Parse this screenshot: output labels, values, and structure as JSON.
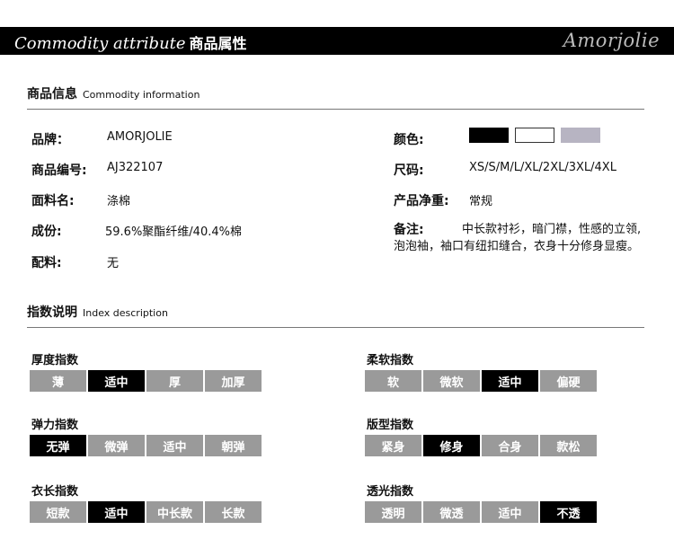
{
  "banner": {
    "title_en": "Commodity attribute",
    "title_zh": "商品属性",
    "brand_script": "Amorjolie"
  },
  "commodity": {
    "heading_zh": "商品信息",
    "heading_en": "Commodity information",
    "left": [
      {
        "label": "品牌：",
        "value": "AMORJOLIE"
      },
      {
        "label": "商品编号:",
        "value": "AJ322107"
      },
      {
        "label": "面料名:",
        "value": "涤棉"
      },
      {
        "label": "成份:",
        "value": "59.6%聚酯纤维/40.4%棉"
      },
      {
        "label": "配料:",
        "value": "无"
      }
    ],
    "color_label": "颜色:",
    "colors": [
      "#000000",
      "#ffffff",
      "#b7b4c2"
    ],
    "size_label": "尺码:",
    "size_value": "XS/S/M/L/XL/2XL/3XL/4XL",
    "weight_label": "产品净重:",
    "weight_value": "常规",
    "note_label": "备注:",
    "note_line1": "中长款衬衫，暗门襟，性感的立领,",
    "note_line2": "泡泡袖，袖口有纽扣缝合，衣身十分修身显瘦。"
  },
  "index": {
    "heading_zh": "指数说明",
    "heading_en": "Index description",
    "groups": [
      {
        "label": "厚度指数",
        "options": [
          "薄",
          "适中",
          "厚",
          "加厚"
        ],
        "selected": 1
      },
      {
        "label": "柔软指数",
        "options": [
          "软",
          "微软",
          "适中",
          "偏硬"
        ],
        "selected": 2
      },
      {
        "label": "弹力指数",
        "options": [
          "无弹",
          "微弹",
          "适中",
          "朝弹"
        ],
        "selected": 0
      },
      {
        "label": "版型指数",
        "options": [
          "紧身",
          "修身",
          "合身",
          "款松"
        ],
        "selected": 1
      },
      {
        "label": "衣长指数",
        "options": [
          "短款",
          "适中",
          "中长款",
          "长款"
        ],
        "selected": 1
      },
      {
        "label": "透光指数",
        "options": [
          "透明",
          "微透",
          "适中",
          "不透"
        ],
        "selected": 3
      }
    ]
  }
}
